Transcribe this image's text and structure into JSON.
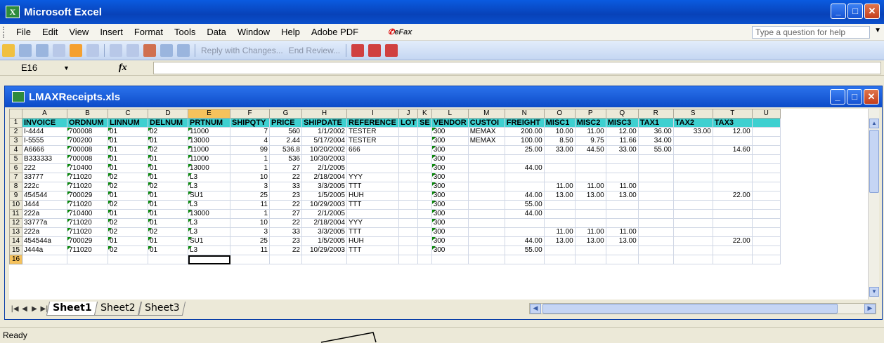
{
  "app": {
    "title": "Microsoft Excel",
    "icon": "excel-icon"
  },
  "menu": [
    "File",
    "Edit",
    "View",
    "Insert",
    "Format",
    "Tools",
    "Data",
    "Window",
    "Help",
    "Adobe PDF"
  ],
  "efax": "eFax",
  "help_placeholder": "Type a question for help",
  "toolbar": {
    "reply_label": "Reply with Changes...",
    "end_review_label": "End Review..."
  },
  "formula": {
    "cell_ref": "E16",
    "fx": "fx",
    "content": ""
  },
  "workbook": {
    "title": "LMAXReceipts.xls"
  },
  "grid": {
    "columns": [
      "A",
      "B",
      "C",
      "D",
      "E",
      "F",
      "G",
      "H",
      "I",
      "J",
      "K",
      "L",
      "M",
      "N",
      "O",
      "P",
      "Q",
      "R",
      "S",
      "T",
      "U"
    ],
    "selected_column": "E",
    "header_row": [
      "INVOICE",
      "ORDNUM",
      "LINNUM",
      "DELNUM",
      "PRTNUM",
      "SHIPQTY",
      "PRICE",
      "SHIPDATE",
      "REFERENCE",
      "LOT",
      "SE",
      "VENDOR",
      "CUSTOI",
      "FREIGHT",
      "MISC1",
      "MISC2",
      "MISC3",
      "TAX1",
      "TAX2",
      "TAX3",
      ""
    ],
    "rows": [
      [
        "I-4444",
        "700008",
        "01",
        "02",
        "11000",
        "7",
        "560",
        "1/1/2002",
        "TESTER",
        "",
        "",
        "300",
        "MEMAX",
        "200.00",
        "10.00",
        "11.00",
        "12.00",
        "36.00",
        "33.00",
        "12.00",
        ""
      ],
      [
        "I-5555",
        "700200",
        "01",
        "01",
        "13000",
        "4",
        "2.44",
        "5/17/2004",
        "TESTER",
        "",
        "",
        "300",
        "MEMAX",
        "100.00",
        "8.50",
        "9.75",
        "11.66",
        "34.00",
        "",
        "",
        ""
      ],
      [
        "A6666",
        "700008",
        "01",
        "02",
        "11000",
        "99",
        "536.8",
        "10/20/2002",
        "666",
        "",
        "",
        "300",
        "",
        "25.00",
        "33.00",
        "44.50",
        "33.00",
        "55.00",
        "",
        "14.60",
        ""
      ],
      [
        "B333333",
        "700008",
        "01",
        "01",
        "11000",
        "1",
        "536",
        "10/30/2003",
        "",
        "",
        "",
        "300",
        "",
        "",
        "",
        "",
        "",
        "",
        "",
        "",
        ""
      ],
      [
        "222",
        "710400",
        "01",
        "01",
        "13000",
        "1",
        "27",
        "2/1/2005",
        "",
        "",
        "",
        "300",
        "",
        "44.00",
        "",
        "",
        "",
        "",
        "",
        "",
        ""
      ],
      [
        "33777",
        "711020",
        "02",
        "01",
        "L3",
        "10",
        "22",
        "2/18/2004",
        "YYY",
        "",
        "",
        "300",
        "",
        "",
        "",
        "",
        "",
        "",
        "",
        "",
        ""
      ],
      [
        "222c",
        "711020",
        "02",
        "02",
        "L3",
        "3",
        "33",
        "3/3/2005",
        "TTT",
        "",
        "",
        "300",
        "",
        "",
        "11.00",
        "11.00",
        "11.00",
        "",
        "",
        "",
        ""
      ],
      [
        "454544",
        "700029",
        "01",
        "01",
        "SU1",
        "25",
        "23",
        "1/5/2005",
        "HUH",
        "",
        "",
        "300",
        "",
        "44.00",
        "13.00",
        "13.00",
        "13.00",
        "",
        "",
        "22.00",
        ""
      ],
      [
        "J444",
        "711020",
        "02",
        "01",
        "L3",
        "11",
        "22",
        "10/29/2003",
        "TTT",
        "",
        "",
        "300",
        "",
        "55.00",
        "",
        "",
        "",
        "",
        "",
        "",
        ""
      ],
      [
        "222a",
        "710400",
        "01",
        "01",
        "13000",
        "1",
        "27",
        "2/1/2005",
        "",
        "",
        "",
        "300",
        "",
        "44.00",
        "",
        "",
        "",
        "",
        "",
        "",
        ""
      ],
      [
        "33777a",
        "711020",
        "02",
        "01",
        "L3",
        "10",
        "22",
        "2/18/2004",
        "YYY",
        "",
        "",
        "300",
        "",
        "",
        "",
        "",
        "",
        "",
        "",
        "",
        ""
      ],
      [
        "222a",
        "711020",
        "02",
        "02",
        "L3",
        "3",
        "33",
        "3/3/2005",
        "TTT",
        "",
        "",
        "300",
        "",
        "",
        "11.00",
        "11.00",
        "11.00",
        "",
        "",
        "",
        ""
      ],
      [
        "454544a",
        "700029",
        "01",
        "01",
        "SU1",
        "25",
        "23",
        "1/5/2005",
        "HUH",
        "",
        "",
        "300",
        "",
        "44.00",
        "13.00",
        "13.00",
        "13.00",
        "",
        "",
        "22.00",
        ""
      ],
      [
        "J444a",
        "711020",
        "02",
        "01",
        "L3",
        "11",
        "22",
        "10/29/2003",
        "TTT",
        "",
        "",
        "300",
        "",
        "55.00",
        "",
        "",
        "",
        "",
        "",
        "",
        ""
      ]
    ],
    "active_row": "16"
  },
  "tabs": [
    "Sheet1",
    "Sheet2",
    "Sheet3"
  ],
  "active_tab": 0,
  "status": "Ready",
  "colors": {
    "header_fill": "#3ed0d0",
    "selection": "#f6c25c",
    "title_blue": "#0a4fcc"
  }
}
